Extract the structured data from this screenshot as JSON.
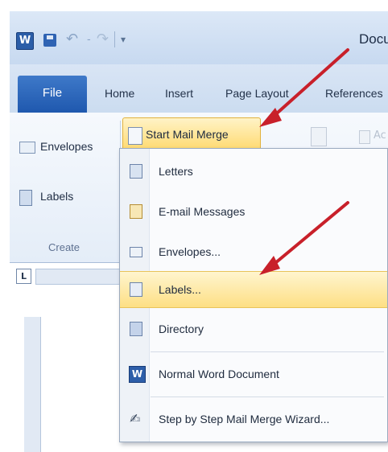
{
  "titlebar": {
    "document_title": "Docu"
  },
  "tabs": [
    "File",
    "Home",
    "Insert",
    "Page Layout",
    "References"
  ],
  "ribbon": {
    "envelopes_label": "Envelopes",
    "labels_label": "Labels",
    "group_label": "Create",
    "start_mail_merge_label": "Start Mail Merge",
    "partial_text": "Ac"
  },
  "ruler": {
    "tab_marker": "L"
  },
  "menu": {
    "items": [
      {
        "label": "Letters",
        "icon": "letters-icon"
      },
      {
        "label": "E-mail Messages",
        "icon": "email-messages-icon"
      },
      {
        "label": "Envelopes...",
        "icon": "envelopes-icon"
      },
      {
        "label": "Labels...",
        "icon": "labels-icon",
        "highlighted": true
      },
      {
        "label": "Directory",
        "icon": "directory-icon"
      },
      {
        "label": "Normal Word Document",
        "icon": "word-document-icon"
      },
      {
        "label": "Step by Step Mail Merge Wizard...",
        "icon": "wizard-icon"
      }
    ]
  },
  "colors": {
    "file_tab": "#2b62b5",
    "highlight": "#fddf84",
    "arrow": "#c8202a"
  }
}
